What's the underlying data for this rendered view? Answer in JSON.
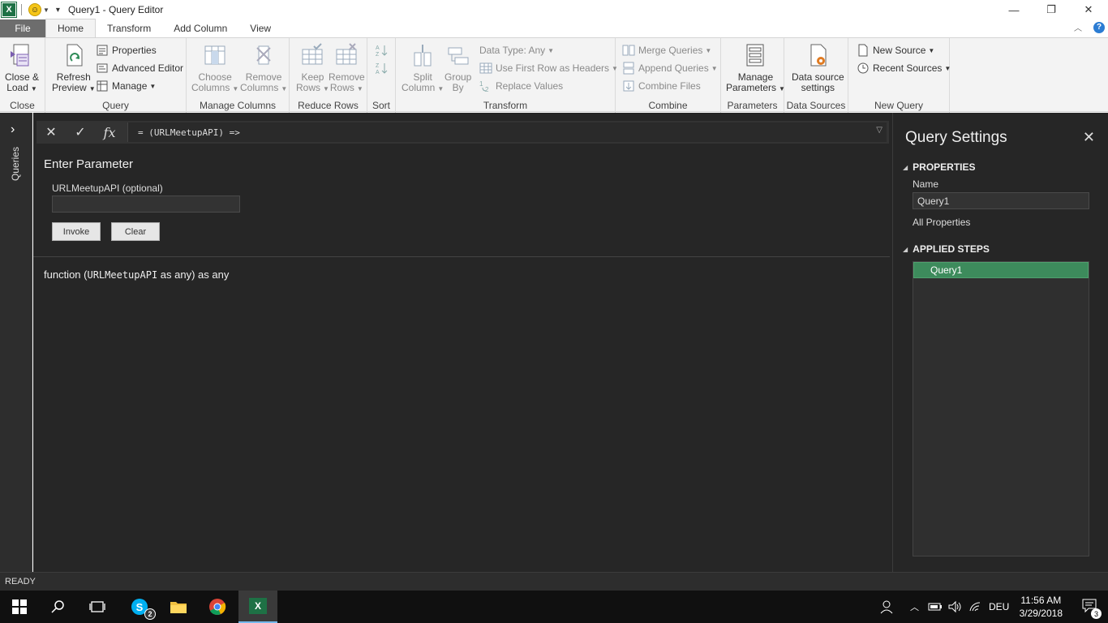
{
  "window": {
    "title": "Query1 - Query Editor",
    "minimize": "—",
    "restore": "❐",
    "close": "✕"
  },
  "tabs": {
    "file": "File",
    "home": "Home",
    "transform": "Transform",
    "add_column": "Add Column",
    "view": "View"
  },
  "ribbon": {
    "close": {
      "btn1": "Close &",
      "btn2": "Load",
      "label": "Close"
    },
    "query": {
      "refresh1": "Refresh",
      "refresh2": "Preview",
      "properties": "Properties",
      "advanced_editor": "Advanced Editor",
      "manage": "Manage",
      "label": "Query"
    },
    "manage_columns": {
      "choose1": "Choose",
      "choose2": "Columns",
      "remove1": "Remove",
      "remove2": "Columns",
      "label": "Manage Columns"
    },
    "reduce_rows": {
      "keep1": "Keep",
      "keep2": "Rows",
      "remove1": "Remove",
      "remove2": "Rows",
      "label": "Reduce Rows"
    },
    "sort": {
      "label": "Sort"
    },
    "transform": {
      "split1": "Split",
      "split2": "Column",
      "group1": "Group",
      "group2": "By",
      "data_type": "Data Type: Any",
      "first_row": "Use First Row as Headers",
      "replace": "Replace Values",
      "label": "Transform"
    },
    "combine": {
      "merge": "Merge Queries",
      "append": "Append Queries",
      "combine_files": "Combine Files",
      "label": "Combine"
    },
    "parameters": {
      "manage1": "Manage",
      "manage2": "Parameters",
      "label": "Parameters"
    },
    "data_sources": {
      "settings1": "Data source",
      "settings2": "settings",
      "label": "Data Sources"
    },
    "new_query": {
      "new_source": "New Source",
      "recent_sources": "Recent Sources",
      "label": "New Query"
    }
  },
  "queries_pane": {
    "label": "Queries"
  },
  "formula": {
    "text": "= (URLMeetupAPI) =>",
    "fx": "fx"
  },
  "parameter": {
    "title": "Enter Parameter",
    "field_label": "URLMeetupAPI (optional)",
    "field_value": "",
    "invoke": "Invoke",
    "clear": "Clear"
  },
  "function_sig": {
    "prefix": "function (",
    "param": "URLMeetupAPI",
    "suffix": " as any) as any"
  },
  "query_settings": {
    "title": "Query Settings",
    "properties_head": "PROPERTIES",
    "name_label": "Name",
    "name_value": "Query1",
    "all_properties": "All Properties",
    "applied_steps_head": "APPLIED STEPS",
    "steps": [
      "Query1"
    ]
  },
  "status": {
    "text": "READY"
  },
  "taskbar": {
    "skype_badge": "2",
    "language": "DEU",
    "time": "11:56 AM",
    "date": "3/29/2018",
    "notifications": "3"
  },
  "colors": {
    "excel_green": "#1e7145",
    "dark_bg": "#262626",
    "step_selected": "#3d8b5c",
    "file_tab": "#6d6d6d"
  }
}
